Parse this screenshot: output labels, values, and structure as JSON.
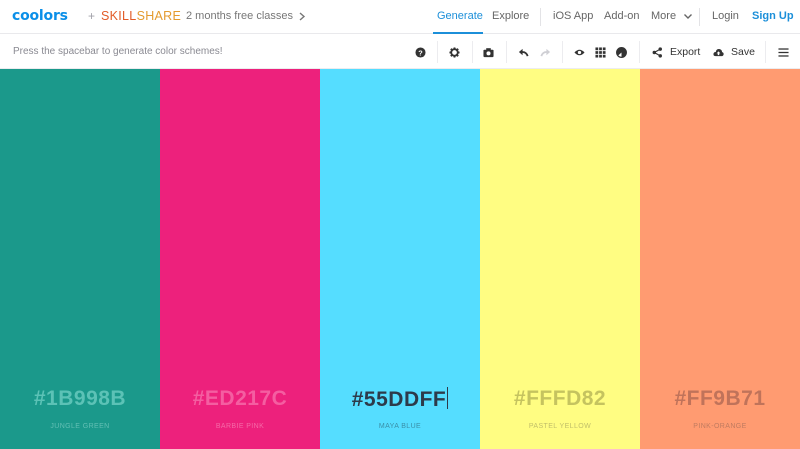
{
  "header": {
    "logo": "coolors",
    "plus": "+",
    "partner_a": "SKILL",
    "partner_b": "SHARE",
    "promo": "2 months free classes",
    "nav": {
      "generate": "Generate",
      "explore": "Explore",
      "ios_app": "iOS App",
      "add_on": "Add-on",
      "more": "More",
      "login": "Login",
      "signup": "Sign Up"
    },
    "icons": {
      "promo_chevron": "chevron-right-icon",
      "more_chevron": "chevron-down-icon"
    }
  },
  "toolbar": {
    "hint": "Press the spacebar to generate color schemes!",
    "export_label": "Export",
    "save_label": "Save",
    "icons": [
      "help-icon",
      "settings-icon",
      "camera-icon",
      "undo-icon",
      "redo-icon",
      "view-icon",
      "grid-icon",
      "contrast-icon",
      "share-icon",
      "cloud-upload-icon",
      "menu-icon"
    ]
  },
  "colors": {
    "accent": "#1c8fd9",
    "logo": "#0a8fe8",
    "skill": "#e25b27",
    "share": "#e49b2f"
  },
  "palette": [
    {
      "hex": "#1B998B",
      "name": "JUNGLE GREEN",
      "bg": "#1b998b",
      "hex_color": "#5cc2b6",
      "name_color": "#62bfb4"
    },
    {
      "hex": "#ED217C",
      "name": "BARBIE PINK",
      "bg": "#ed217c",
      "hex_color": "#f45ea1",
      "name_color": "#f56aa8"
    },
    {
      "hex": "#55DDFF",
      "name": "MAYA BLUE",
      "bg": "#55ddff",
      "hex_color": "#2d3a4a",
      "name_color": "#3a8fa8"
    },
    {
      "hex": "#FFFD82",
      "name": "PASTEL YELLOW",
      "bg": "#fffd82",
      "hex_color": "#c5c35f",
      "name_color": "#c1bf6a"
    },
    {
      "hex": "#FF9B71",
      "name": "PINK-ORANGE",
      "bg": "#ff9b71",
      "hex_color": "#c0735a",
      "name_color": "#c07b60"
    }
  ]
}
